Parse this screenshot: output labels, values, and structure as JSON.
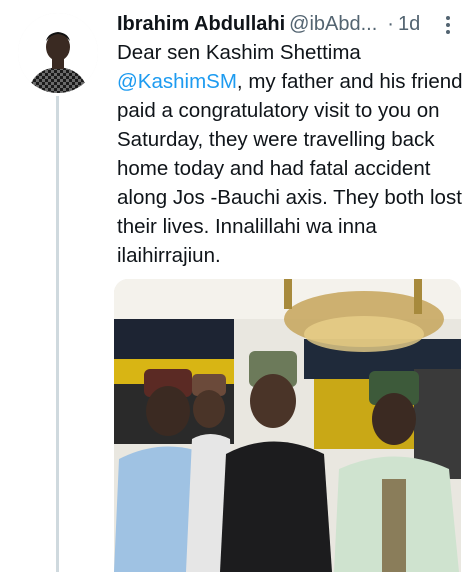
{
  "tweet": {
    "author_name": "Ibrahim Abdullahi",
    "handle": "@ibAbd...",
    "separator": "·",
    "time": "1d",
    "text_before": "Dear sen Kashim Shettima ",
    "mention": "@KashimSM",
    "text_after": ", my father and his friend paid a congratulatory visit to you on Saturday, they were travelling back home today and had fatal accident along Jos -Bauchi axis. They both lost their lives. Innalillahi wa inna ilaihirrajiun."
  },
  "icons": {
    "more": "more-vertical-icon",
    "avatar": "avatar"
  },
  "colors": {
    "mention": "#1d9bf0",
    "secondary_text": "#536471",
    "thread_line": "#cfd9de"
  }
}
